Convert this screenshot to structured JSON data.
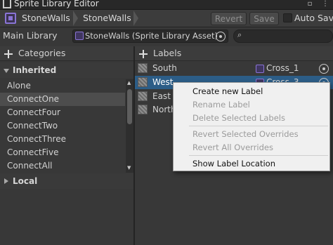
{
  "window": {
    "title": "Sprite Library Editor"
  },
  "toolbar": {
    "breadcrumbs": [
      "StoneWalls",
      "StoneWalls"
    ],
    "revert_label": "Revert",
    "save_label": "Save",
    "auto_save_label": "Auto Save",
    "auto_save_checked": false
  },
  "library": {
    "label": "Main Library",
    "asset_value": "StoneWalls (Sprite Library Asset)",
    "search_value": ""
  },
  "categories": {
    "header": "Categories",
    "inherited_section": "Inherited",
    "items": [
      "Alone",
      "ConnectOne",
      "ConnectFour",
      "ConnectTwo",
      "ConnectThree",
      "ConnectFive",
      "ConnectAll"
    ],
    "selected_index": 1,
    "local_section": "Local"
  },
  "labels": {
    "header": "Labels",
    "rows": [
      {
        "name": "South",
        "sprite": "Cross_1"
      },
      {
        "name": "West",
        "sprite": "Cross_3"
      },
      {
        "name": "East",
        "sprite": ""
      },
      {
        "name": "North",
        "sprite": ""
      }
    ],
    "selected_index": 1
  },
  "context_menu": {
    "items": [
      {
        "label": "Create new Label",
        "enabled": true
      },
      {
        "label": "Rename Label",
        "enabled": false
      },
      {
        "label": "Delete Selected Labels",
        "enabled": false
      },
      {
        "label": "Revert Selected Overrides",
        "enabled": false
      },
      {
        "label": "Revert All Overrides",
        "enabled": false
      },
      {
        "label": "Show Label Location",
        "enabled": true
      }
    ]
  },
  "colors": {
    "background": "#383838",
    "selection_blue": "#2c5d87",
    "asset_accent": "#8a74d6",
    "menu_background": "#f0f0f0"
  },
  "icons": {
    "breadcrumb": "sprite-library-asset-icon",
    "add": "plus-icon",
    "picker": "object-picker-icon",
    "search": "search-icon",
    "expand": "triangle-down-icon",
    "collapse": "triangle-right-icon"
  }
}
